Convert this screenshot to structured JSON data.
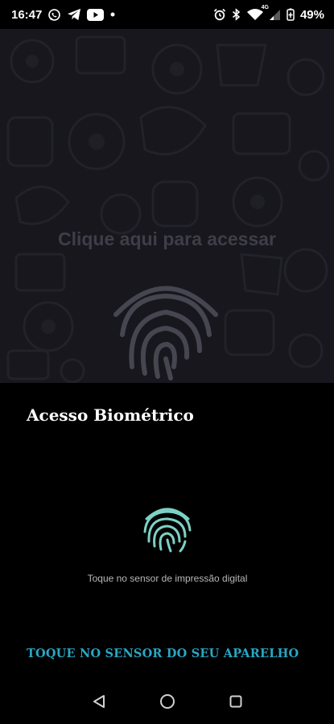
{
  "status_bar": {
    "time": "16:47",
    "left_icons": [
      "whatsapp-icon",
      "telegram-icon",
      "youtube-icon",
      "dot-icon"
    ],
    "right_icons": [
      "alarm-icon",
      "bluetooth-icon",
      "wifi-icon",
      "signal-icon",
      "battery-saver-icon"
    ],
    "wifi_badge": "4G",
    "battery": "49%"
  },
  "background": {
    "prompt": "Clique aqui para acessar",
    "icon": "fingerprint-icon"
  },
  "dialog": {
    "title": "Acesso Biométrico",
    "hint": "Toque no sensor de impressão digital",
    "action": "TOQUE NO SENSOR DO SEU APARELHO",
    "accent": "#2aa6c4",
    "fingerprint_color": "#7dd1c6"
  },
  "nav_bar": {
    "buttons": [
      "back-icon",
      "home-icon",
      "recents-icon"
    ]
  }
}
